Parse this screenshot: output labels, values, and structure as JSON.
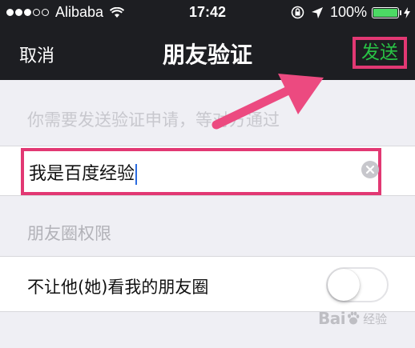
{
  "status_bar": {
    "carrier": "Alibaba",
    "time": "17:42",
    "battery": "100%",
    "signal_bars_filled": 3,
    "signal_bars_total": 5,
    "battery_level": 1.0,
    "icons": [
      "wifi-icon",
      "orientation-lock-icon",
      "location-arrow-icon",
      "charging-bolt-icon"
    ]
  },
  "nav": {
    "cancel_label": "取消",
    "title": "朋友验证",
    "send_label": "发送"
  },
  "form": {
    "hint": "你需要发送验证申请，等对方通过",
    "input_value": "我是百度经验",
    "section_label": "朋友圈权限",
    "toggle_label": "不让他(她)看我的朋友圈",
    "toggle_on": false
  },
  "watermark": {
    "brand": "Bai",
    "sub": "经验",
    "url": "jingyan.baidu.com"
  },
  "colors": {
    "nav_background": "#1d1e22",
    "send_text": "#29c245",
    "highlight": "#e23873",
    "page_background": "#efeff4",
    "battery_fill": "#4cd964"
  }
}
